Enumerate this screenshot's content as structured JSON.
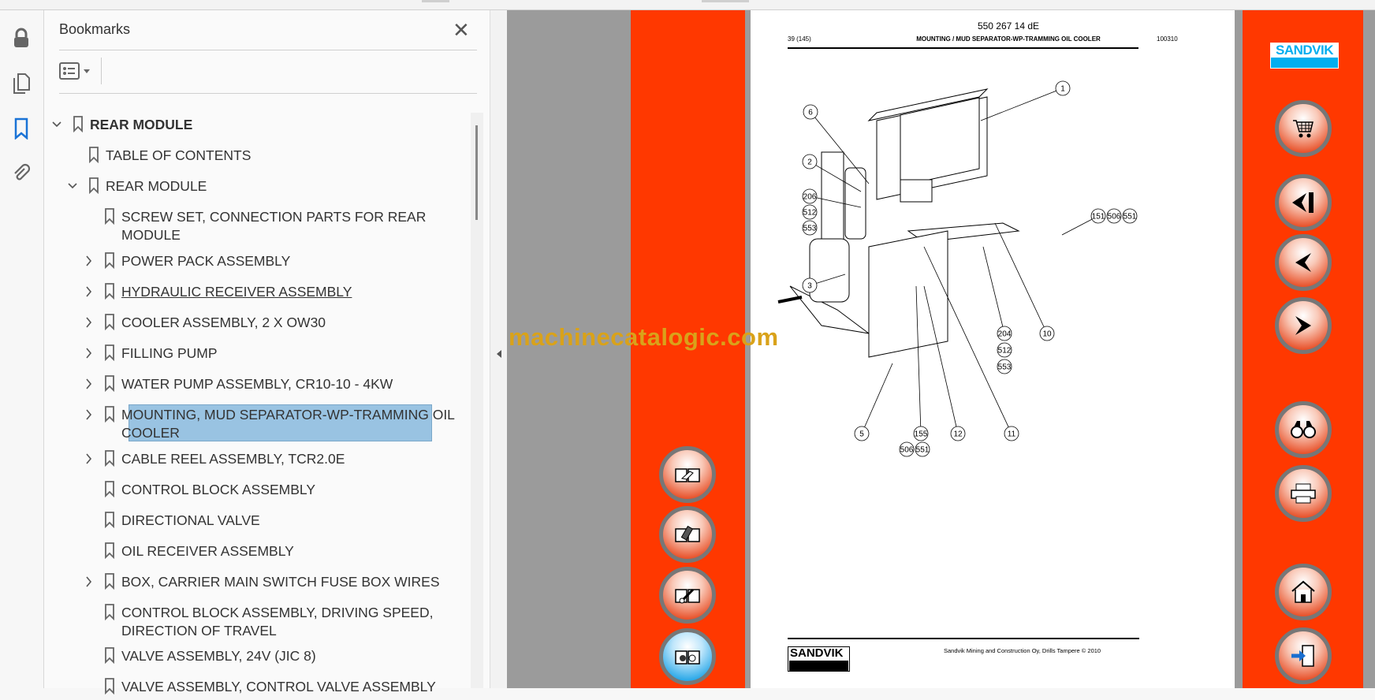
{
  "sidebar_rail": {
    "icons": [
      "lock-icon",
      "pages-icon",
      "bookmark-icon",
      "attachment-icon"
    ]
  },
  "bookmarks_panel": {
    "title": "Bookmarks",
    "close_glyph": "✕",
    "items": [
      {
        "label": "REAR MODULE",
        "level": 0,
        "expanded": true,
        "bold": true
      },
      {
        "label": "TABLE OF CONTENTS",
        "level": 1
      },
      {
        "label": "REAR MODULE",
        "level": 1,
        "expanded": true
      },
      {
        "label": "SCREW SET, CONNECTION PARTS FOR REAR",
        "label2": "MODULE",
        "level": 2
      },
      {
        "label": "POWER PACK ASSEMBLY",
        "level": 2,
        "collapsed": true
      },
      {
        "label": "HYDRAULIC RECEIVER ASSEMBLY",
        "level": 2,
        "collapsed": true,
        "underline": true
      },
      {
        "label": "COOLER ASSEMBLY, 2 X OW30",
        "level": 2,
        "collapsed": true
      },
      {
        "label": "FILLING PUMP",
        "level": 2,
        "collapsed": true
      },
      {
        "label": "WATER PUMP ASSEMBLY, CR10-10 - 4KW",
        "level": 2,
        "collapsed": true
      },
      {
        "label": "MOUNTING, MUD SEPARATOR-WP-TRAMMING OIL",
        "label2": "COOLER",
        "level": 2,
        "collapsed": true,
        "selected": true
      },
      {
        "label": "CABLE REEL ASSEMBLY, TCR2.0E",
        "level": 2,
        "collapsed": true
      },
      {
        "label": "CONTROL BLOCK ASSEMBLY",
        "level": 2
      },
      {
        "label": "DIRECTIONAL VALVE",
        "level": 2
      },
      {
        "label": "OIL RECEIVER ASSEMBLY",
        "level": 2
      },
      {
        "label": "BOX, CARRIER MAIN SWITCH FUSE BOX WIRES",
        "level": 2,
        "collapsed": true
      },
      {
        "label": "CONTROL BLOCK ASSEMBLY, DRIVING SPEED,",
        "label2": "DIRECTION OF TRAVEL",
        "level": 2
      },
      {
        "label": "VALVE ASSEMBLY, 24V (JIC 8)",
        "level": 2
      },
      {
        "label": "VALVE ASSEMBLY, CONTROL VALVE ASSEMBLY",
        "level": 2
      }
    ]
  },
  "watermark": "machinecatalogic.com",
  "page": {
    "doc_number": "550 267 14 dE",
    "page_ref": "39 (145)",
    "heading": "MOUNTING / MUD SEPARATOR-WP-TRAMMING OIL COOLER",
    "date_code": "100310",
    "footer_logo": "SANDVIK",
    "footer_text": "Sandvik Mining and Construction Oy, Drills Tampere © 2010",
    "callouts": [
      "1",
      "6",
      "2",
      "206",
      "512",
      "553",
      "151",
      "506",
      "551",
      "3",
      "10",
      "204",
      "512",
      "553",
      "5",
      "155",
      "506",
      "551",
      "12",
      "11"
    ]
  },
  "right_strip": {
    "logo": "SANDVIK",
    "buttons": [
      "cart",
      "first-page",
      "previous-page",
      "next-page",
      "find",
      "print",
      "home",
      "exit"
    ]
  },
  "left_strip": {
    "buttons": [
      "manual-hand",
      "manual-remote",
      "manual-tool",
      "manual-parts"
    ]
  },
  "colors": {
    "orange": "#ff3800",
    "selection": "#99c3e2",
    "viewer_gray": "#9b9b9b",
    "sandvik_blue": "#00aeef"
  }
}
